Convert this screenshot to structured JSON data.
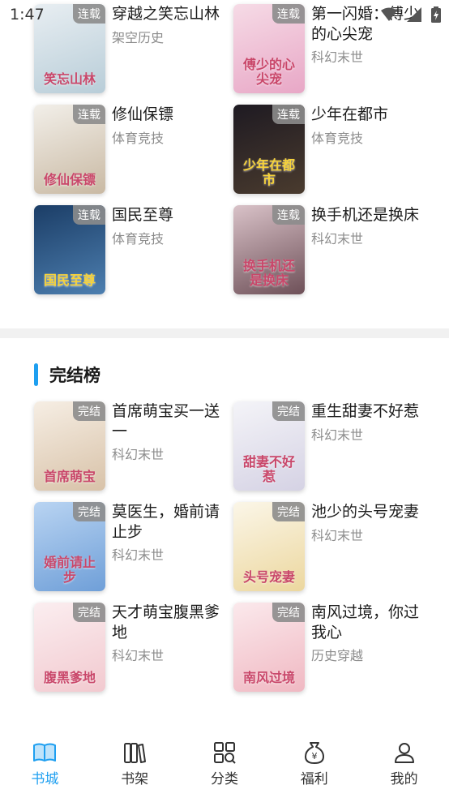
{
  "status": {
    "time": "1:47"
  },
  "serial_books": [
    {
      "title": "穿越之笑忘山林",
      "category": "架空历史",
      "badge": "连载",
      "cover_text": "笑忘山林",
      "cover_colors": [
        "#e8eef2",
        "#b8cdd8"
      ]
    },
    {
      "title": "第一闪婚：傅少的心尖宠",
      "category": "科幻末世",
      "badge": "连载",
      "cover_text": "傅少的心尖宠",
      "cover_colors": [
        "#f6dbe6",
        "#e8a7c6"
      ]
    },
    {
      "title": "修仙保镖",
      "category": "体育竞技",
      "badge": "连载",
      "cover_text": "修仙保镖",
      "cover_colors": [
        "#f2efe9",
        "#c9b9a3"
      ]
    },
    {
      "title": "少年在都市",
      "category": "体育竞技",
      "badge": "连载",
      "cover_text": "少年在都市",
      "cover_colors": [
        "#1e1a22",
        "#4a3b2e"
      ]
    },
    {
      "title": "国民至尊",
      "category": "体育竞技",
      "badge": "连载",
      "cover_text": "国民至尊",
      "cover_colors": [
        "#1b3d66",
        "#4d7fb0"
      ]
    },
    {
      "title": "换手机还是换床",
      "category": "科幻末世",
      "badge": "连载",
      "cover_text": "换手机还是换床",
      "cover_colors": [
        "#d9c2c8",
        "#6e5058"
      ]
    }
  ],
  "section": {
    "title": "完结榜"
  },
  "finished_books": [
    {
      "title": "首席萌宝买一送一",
      "category": "科幻末世",
      "badge": "完结",
      "cover_text": "首席萌宝",
      "cover_colors": [
        "#f6eee4",
        "#d8c2a8"
      ]
    },
    {
      "title": "重生甜妻不好惹",
      "category": "科幻末世",
      "badge": "完结",
      "cover_text": "甜妻不好惹",
      "cover_colors": [
        "#f4f4f8",
        "#d5d2e4"
      ]
    },
    {
      "title": "莫医生，婚前请止步",
      "category": "科幻末世",
      "badge": "完结",
      "cover_text": "婚前请止步",
      "cover_colors": [
        "#b9d4f2",
        "#6f9fd8"
      ]
    },
    {
      "title": "池少的头号宠妻",
      "category": "科幻末世",
      "badge": "完结",
      "cover_text": "头号宠妻",
      "cover_colors": [
        "#fbf6e8",
        "#ecd79e"
      ]
    },
    {
      "title": "天才萌宝腹黑爹地",
      "category": "科幻末世",
      "badge": "完结",
      "cover_text": "腹黑爹地",
      "cover_colors": [
        "#fbeef0",
        "#f2c9cf"
      ]
    },
    {
      "title": "南风过境，你过我心",
      "category": "历史穿越",
      "badge": "完结",
      "cover_text": "南风过境",
      "cover_colors": [
        "#fbe9ec",
        "#f0b8c2"
      ]
    }
  ],
  "tabs": [
    {
      "label": "书城",
      "icon": "book-open-icon",
      "active": true
    },
    {
      "label": "书架",
      "icon": "bookshelf-icon",
      "active": false
    },
    {
      "label": "分类",
      "icon": "category-search-icon",
      "active": false
    },
    {
      "label": "福利",
      "icon": "money-bag-icon",
      "active": false
    },
    {
      "label": "我的",
      "icon": "person-icon",
      "active": false
    }
  ],
  "colors": {
    "accent": "#1e9ff0",
    "badge_bg": "#8c8c8c",
    "secondary_text": "#8c8c8c"
  }
}
